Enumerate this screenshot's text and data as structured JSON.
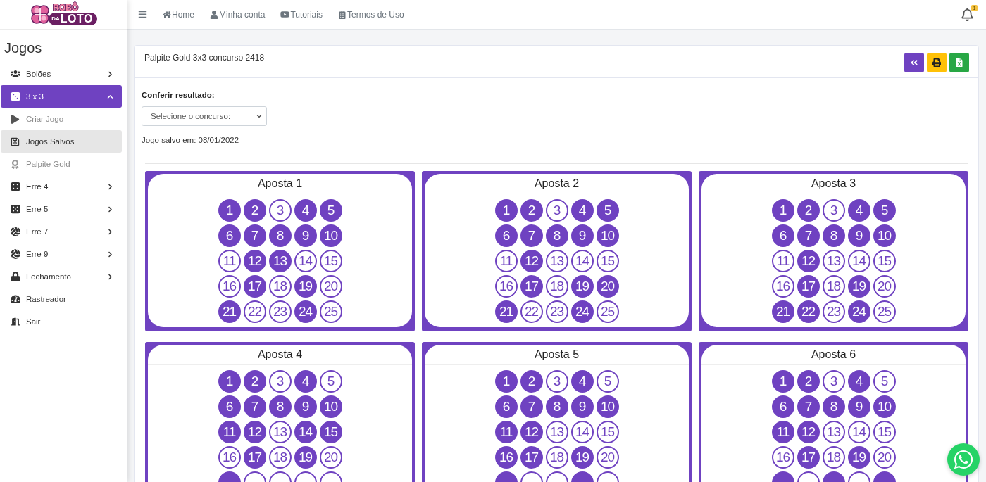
{
  "logo": {
    "top": "ROBÔ",
    "small": "DA",
    "main": "LOTO"
  },
  "sidebar": {
    "title": "Jogos",
    "items": [
      {
        "label": "Bolões",
        "kind": "submenu",
        "expanded": false,
        "selected": false
      },
      {
        "label": "3 x 3",
        "kind": "submenu",
        "expanded": true,
        "selected": true,
        "children": [
          {
            "label": "Criar Jogo",
            "selected": false
          },
          {
            "label": "Jogos Salvos",
            "selected": true
          },
          {
            "label": "Palpite Gold",
            "selected": false
          }
        ]
      },
      {
        "label": "Erre 4",
        "kind": "submenu",
        "expanded": false,
        "selected": false
      },
      {
        "label": "Erre 5",
        "kind": "submenu",
        "expanded": false,
        "selected": false
      },
      {
        "label": "Erre 7",
        "kind": "submenu",
        "expanded": false,
        "selected": false
      },
      {
        "label": "Erre 9",
        "kind": "submenu",
        "expanded": false,
        "selected": false
      },
      {
        "label": "Fechamento",
        "kind": "submenu",
        "expanded": false,
        "selected": false
      },
      {
        "label": "Rastreador",
        "kind": "link",
        "selected": false
      },
      {
        "label": "Sair",
        "kind": "link",
        "selected": false
      }
    ]
  },
  "topbar": {
    "links": [
      {
        "label": "Home"
      },
      {
        "label": "Minha conta"
      },
      {
        "label": "Tutoriais"
      },
      {
        "label": "Termos de Uso"
      }
    ],
    "notifications": {
      "count": "1"
    }
  },
  "card": {
    "title": "Palpite Gold 3x3 concurso 2418",
    "check_label": "Conferir resultado:",
    "contest_select": {
      "placeholder": "Selecione o concurso:"
    },
    "saved_on": "Jogo salvo em: 08/01/2022"
  },
  "bets": [
    {
      "title": "Aposta 1",
      "numbers": [
        {
          "label": "1",
          "selected": true
        },
        {
          "label": "2",
          "selected": true
        },
        {
          "label": "3",
          "selected": false
        },
        {
          "label": "4",
          "selected": true
        },
        {
          "label": "5",
          "selected": true
        },
        {
          "label": "6",
          "selected": true
        },
        {
          "label": "7",
          "selected": true
        },
        {
          "label": "8",
          "selected": true
        },
        {
          "label": "9",
          "selected": true
        },
        {
          "label": "10",
          "selected": true
        },
        {
          "label": "11",
          "selected": false
        },
        {
          "label": "12",
          "selected": true
        },
        {
          "label": "13",
          "selected": true
        },
        {
          "label": "14",
          "selected": false
        },
        {
          "label": "15",
          "selected": false
        },
        {
          "label": "16",
          "selected": false
        },
        {
          "label": "17",
          "selected": true
        },
        {
          "label": "18",
          "selected": false
        },
        {
          "label": "19",
          "selected": true
        },
        {
          "label": "20",
          "selected": false
        },
        {
          "label": "21",
          "selected": true
        },
        {
          "label": "22",
          "selected": false
        },
        {
          "label": "23",
          "selected": false
        },
        {
          "label": "24",
          "selected": true
        },
        {
          "label": "25",
          "selected": false
        }
      ]
    },
    {
      "title": "Aposta 2",
      "numbers": [
        {
          "label": "1",
          "selected": true
        },
        {
          "label": "2",
          "selected": true
        },
        {
          "label": "3",
          "selected": false
        },
        {
          "label": "4",
          "selected": true
        },
        {
          "label": "5",
          "selected": true
        },
        {
          "label": "6",
          "selected": true
        },
        {
          "label": "7",
          "selected": true
        },
        {
          "label": "8",
          "selected": true
        },
        {
          "label": "9",
          "selected": true
        },
        {
          "label": "10",
          "selected": true
        },
        {
          "label": "11",
          "selected": false
        },
        {
          "label": "12",
          "selected": true
        },
        {
          "label": "13",
          "selected": false
        },
        {
          "label": "14",
          "selected": false
        },
        {
          "label": "15",
          "selected": false
        },
        {
          "label": "16",
          "selected": false
        },
        {
          "label": "17",
          "selected": true
        },
        {
          "label": "18",
          "selected": false
        },
        {
          "label": "19",
          "selected": true
        },
        {
          "label": "20",
          "selected": true
        },
        {
          "label": "21",
          "selected": true
        },
        {
          "label": "22",
          "selected": false
        },
        {
          "label": "23",
          "selected": false
        },
        {
          "label": "24",
          "selected": true
        },
        {
          "label": "25",
          "selected": false
        }
      ]
    },
    {
      "title": "Aposta 3",
      "numbers": [
        {
          "label": "1",
          "selected": true
        },
        {
          "label": "2",
          "selected": true
        },
        {
          "label": "3",
          "selected": false
        },
        {
          "label": "4",
          "selected": true
        },
        {
          "label": "5",
          "selected": true
        },
        {
          "label": "6",
          "selected": true
        },
        {
          "label": "7",
          "selected": true
        },
        {
          "label": "8",
          "selected": true
        },
        {
          "label": "9",
          "selected": true
        },
        {
          "label": "10",
          "selected": true
        },
        {
          "label": "11",
          "selected": false
        },
        {
          "label": "12",
          "selected": true
        },
        {
          "label": "13",
          "selected": false
        },
        {
          "label": "14",
          "selected": false
        },
        {
          "label": "15",
          "selected": false
        },
        {
          "label": "16",
          "selected": false
        },
        {
          "label": "17",
          "selected": true
        },
        {
          "label": "18",
          "selected": false
        },
        {
          "label": "19",
          "selected": true
        },
        {
          "label": "20",
          "selected": false
        },
        {
          "label": "21",
          "selected": true
        },
        {
          "label": "22",
          "selected": true
        },
        {
          "label": "23",
          "selected": false
        },
        {
          "label": "24",
          "selected": true
        },
        {
          "label": "25",
          "selected": false
        }
      ]
    },
    {
      "title": "Aposta 4",
      "numbers": [
        {
          "label": "1",
          "selected": true
        },
        {
          "label": "2",
          "selected": true
        },
        {
          "label": "3",
          "selected": false
        },
        {
          "label": "4",
          "selected": true
        },
        {
          "label": "5",
          "selected": false
        },
        {
          "label": "6",
          "selected": true
        },
        {
          "label": "7",
          "selected": true
        },
        {
          "label": "8",
          "selected": true
        },
        {
          "label": "9",
          "selected": true
        },
        {
          "label": "10",
          "selected": true
        },
        {
          "label": "11",
          "selected": true
        },
        {
          "label": "12",
          "selected": true
        },
        {
          "label": "13",
          "selected": false
        },
        {
          "label": "14",
          "selected": true
        },
        {
          "label": "15",
          "selected": true
        },
        {
          "label": "16",
          "selected": false
        },
        {
          "label": "17",
          "selected": true
        },
        {
          "label": "18",
          "selected": false
        },
        {
          "label": "19",
          "selected": true
        },
        {
          "label": "20",
          "selected": false
        },
        {
          "selected": true
        },
        {
          "selected": false
        },
        {
          "selected": false
        },
        {
          "selected": false
        },
        {
          "selected": false
        }
      ]
    },
    {
      "title": "Aposta 5",
      "numbers": [
        {
          "label": "1",
          "selected": true
        },
        {
          "label": "2",
          "selected": true
        },
        {
          "label": "3",
          "selected": false
        },
        {
          "label": "4",
          "selected": true
        },
        {
          "label": "5",
          "selected": false
        },
        {
          "label": "6",
          "selected": true
        },
        {
          "label": "7",
          "selected": true
        },
        {
          "label": "8",
          "selected": true
        },
        {
          "label": "9",
          "selected": true
        },
        {
          "label": "10",
          "selected": true
        },
        {
          "label": "11",
          "selected": true
        },
        {
          "label": "12",
          "selected": true
        },
        {
          "label": "13",
          "selected": false
        },
        {
          "label": "14",
          "selected": false
        },
        {
          "label": "15",
          "selected": false
        },
        {
          "label": "16",
          "selected": true
        },
        {
          "label": "17",
          "selected": true
        },
        {
          "label": "18",
          "selected": false
        },
        {
          "label": "19",
          "selected": true
        },
        {
          "label": "20",
          "selected": false
        },
        {
          "selected": true
        },
        {
          "selected": false
        },
        {
          "selected": false
        },
        {
          "selected": true
        },
        {
          "selected": false
        }
      ]
    },
    {
      "title": "Aposta 6",
      "numbers": [
        {
          "label": "1",
          "selected": true
        },
        {
          "label": "2",
          "selected": true
        },
        {
          "label": "3",
          "selected": false
        },
        {
          "label": "4",
          "selected": true
        },
        {
          "label": "5",
          "selected": false
        },
        {
          "label": "6",
          "selected": true
        },
        {
          "label": "7",
          "selected": true
        },
        {
          "label": "8",
          "selected": true
        },
        {
          "label": "9",
          "selected": true
        },
        {
          "label": "10",
          "selected": true
        },
        {
          "label": "11",
          "selected": true
        },
        {
          "label": "12",
          "selected": true
        },
        {
          "label": "13",
          "selected": false
        },
        {
          "label": "14",
          "selected": false
        },
        {
          "label": "15",
          "selected": false
        },
        {
          "label": "16",
          "selected": false
        },
        {
          "label": "17",
          "selected": true
        },
        {
          "label": "18",
          "selected": false
        },
        {
          "label": "19",
          "selected": true
        },
        {
          "label": "20",
          "selected": false
        },
        {
          "selected": true
        },
        {
          "selected": false
        },
        {
          "selected": true
        },
        {
          "selected": false
        },
        {
          "selected": true
        }
      ]
    }
  ]
}
